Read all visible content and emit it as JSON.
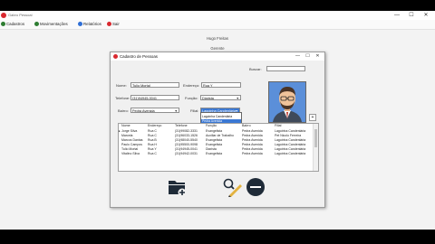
{
  "app": {
    "title": "Gabro Pessoal"
  },
  "window_controls": {
    "minimize": "—",
    "maximize": "☐",
    "close": "✕"
  },
  "menu": [
    {
      "label": "Cadastros",
      "color": "#2e7d32"
    },
    {
      "label": "Movimentações",
      "color": "#2e7d32"
    },
    {
      "label": "Relatórios",
      "color": "#2f6fd6"
    },
    {
      "label": "Sair",
      "color": "#d9282f"
    }
  ],
  "user": {
    "name": "Hugo Freitas",
    "role": "Gerente"
  },
  "dialog": {
    "title": "Cadastro de Pessoas",
    "labels": {
      "buscar": "Buscar:",
      "nome": "Nome:",
      "endereco": "Endereço:",
      "telefone": "Telefone:",
      "funcao": "Função:",
      "bairro": "Bairro:",
      "filial": "Filial:"
    },
    "values": {
      "buscar": "",
      "nome": "Tulio Mortal",
      "endereco": "Rua Y",
      "telefone": "(31)94945-0041",
      "funcao": "Diarista",
      "bairro": "Pedra Avenida",
      "filial": "Lagoinha Candenlária"
    },
    "filial_options": [
      "Lagoinha Candenlária",
      "Pedra Avenida"
    ],
    "table": {
      "headers": [
        "Nome",
        "Endereço",
        "Telefone",
        "Função",
        "Bairro",
        "Filial"
      ],
      "rows": [
        [
          "Jorge Silva",
          "Rua C",
          "(31)99082-3331",
          "Evangelista",
          "Pedra Avenida",
          "Lagoinha Candenlária"
        ],
        [
          "Marcela",
          "Rua C",
          "(31)96033-1526",
          "Auxiliar de Trabalho",
          "Pedra Avenida",
          "Pet Nicolo Ferreira"
        ],
        [
          "Marcos Dantas",
          "Rua B",
          "(31)98040-5540",
          "Evangelista",
          "Pedra Avenida",
          "Lagoinha Candenlária"
        ],
        [
          "Paulo Campos",
          "Rua H",
          "(31)95500-9098",
          "Evangelista",
          "Pedra Avenida",
          "Lagoinha Candenlária"
        ],
        [
          "Tulio Mortal",
          "Rua Y",
          "(31)94945-0041",
          "Diarista",
          "Pedra Avenida",
          "Lagoinha Candenlária"
        ],
        [
          "Vitalino Silva",
          "Rua C",
          "(31)94942-0031",
          "Evangelista",
          "Pedra Avenida",
          "Lagoinha Candenlária"
        ]
      ]
    }
  }
}
